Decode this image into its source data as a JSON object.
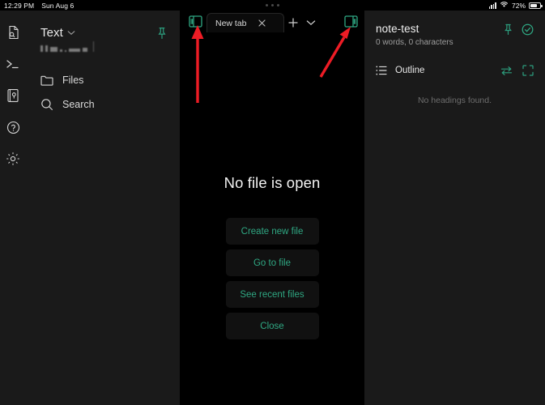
{
  "statusbar": {
    "time": "12:29 PM",
    "date": "Sun Aug 6",
    "battery_percent": "72%",
    "wifi_icon": "wifi-icon",
    "signal_icon": "cellular-signal-icon",
    "battery_icon": "battery-icon",
    "multitask_handle": "three-dots-handle"
  },
  "sidebar": {
    "rail": [
      {
        "name": "file-search-icon"
      },
      {
        "name": "terminal-icon"
      },
      {
        "name": "key-vault-icon"
      },
      {
        "name": "help-circle-icon"
      },
      {
        "name": "settings-gear-icon"
      }
    ],
    "title": "Text",
    "chevron_icon": "chevron-down-icon",
    "pin_icon": "pin-icon",
    "items": [
      {
        "label": "Files",
        "icon": "folder-icon"
      },
      {
        "label": "Search",
        "icon": "search-icon"
      }
    ]
  },
  "center": {
    "left_toggle_icon": "toggle-left-sidebar-icon",
    "right_toggle_icon": "toggle-right-sidebar-icon",
    "tab": {
      "label": "New tab",
      "close_icon": "close-icon"
    },
    "new_tab_icon": "plus-icon",
    "tab_menu_icon": "chevron-down-icon",
    "empty_title": "No file is open",
    "buttons": [
      {
        "label": "Create new file"
      },
      {
        "label": "Go to file"
      },
      {
        "label": "See recent files"
      },
      {
        "label": "Close"
      }
    ]
  },
  "right_panel": {
    "title": "note-test",
    "stats": "0 words, 0 characters",
    "pin_icon": "pin-icon",
    "check_icon": "check-circle-icon",
    "outline_label": "Outline",
    "outline_icon": "list-icon",
    "swap_icon": "swap-arrows-icon",
    "expand_icon": "expand-icon",
    "empty_text": "No headings found."
  },
  "colors": {
    "accent_teal": "#2fa883",
    "annotation_red": "#ee1c25",
    "panel_bg": "#1a1a1a",
    "editor_bg": "#000000"
  },
  "annotations": [
    {
      "name": "arrow-to-left-sidebar-toggle",
      "shape": "vertical-arrow-up"
    },
    {
      "name": "arrow-to-right-sidebar-toggle",
      "shape": "diagonal-arrow-up-right"
    }
  ]
}
